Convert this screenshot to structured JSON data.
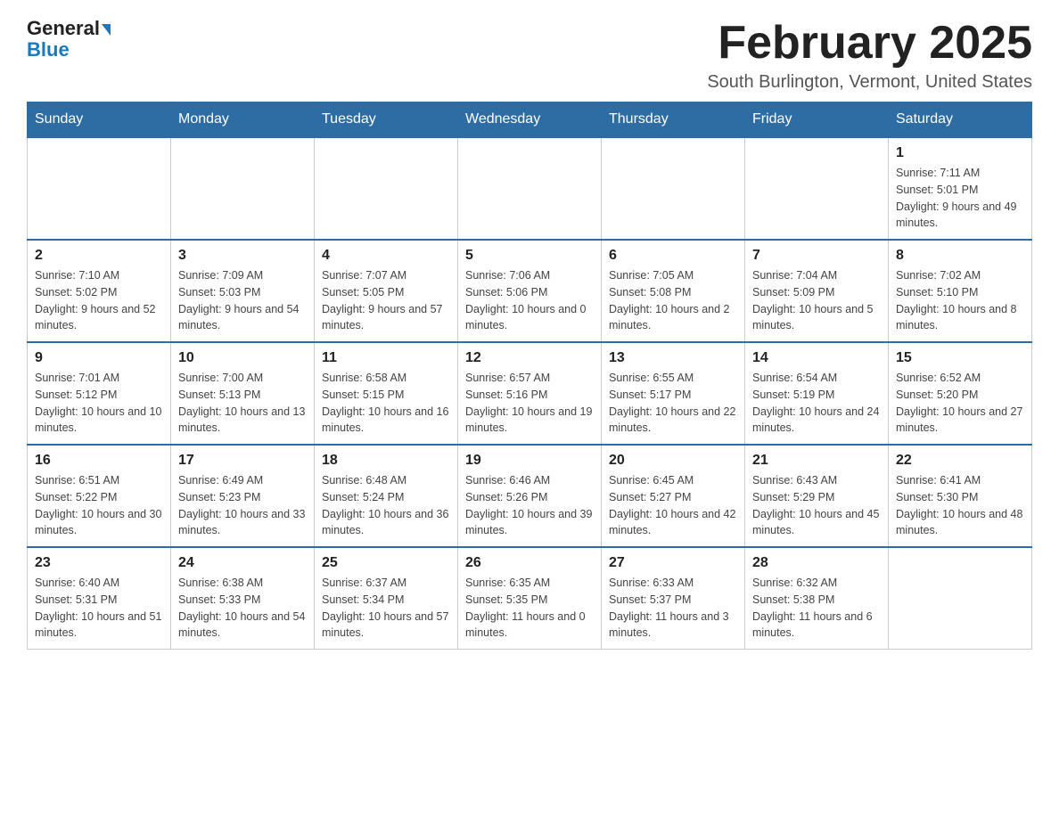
{
  "header": {
    "logo_line1": "General",
    "logo_line2": "Blue",
    "month_title": "February 2025",
    "location": "South Burlington, Vermont, United States"
  },
  "weekdays": [
    "Sunday",
    "Monday",
    "Tuesday",
    "Wednesday",
    "Thursday",
    "Friday",
    "Saturday"
  ],
  "weeks": [
    [
      {
        "day": "",
        "info": ""
      },
      {
        "day": "",
        "info": ""
      },
      {
        "day": "",
        "info": ""
      },
      {
        "day": "",
        "info": ""
      },
      {
        "day": "",
        "info": ""
      },
      {
        "day": "",
        "info": ""
      },
      {
        "day": "1",
        "info": "Sunrise: 7:11 AM\nSunset: 5:01 PM\nDaylight: 9 hours and 49 minutes."
      }
    ],
    [
      {
        "day": "2",
        "info": "Sunrise: 7:10 AM\nSunset: 5:02 PM\nDaylight: 9 hours and 52 minutes."
      },
      {
        "day": "3",
        "info": "Sunrise: 7:09 AM\nSunset: 5:03 PM\nDaylight: 9 hours and 54 minutes."
      },
      {
        "day": "4",
        "info": "Sunrise: 7:07 AM\nSunset: 5:05 PM\nDaylight: 9 hours and 57 minutes."
      },
      {
        "day": "5",
        "info": "Sunrise: 7:06 AM\nSunset: 5:06 PM\nDaylight: 10 hours and 0 minutes."
      },
      {
        "day": "6",
        "info": "Sunrise: 7:05 AM\nSunset: 5:08 PM\nDaylight: 10 hours and 2 minutes."
      },
      {
        "day": "7",
        "info": "Sunrise: 7:04 AM\nSunset: 5:09 PM\nDaylight: 10 hours and 5 minutes."
      },
      {
        "day": "8",
        "info": "Sunrise: 7:02 AM\nSunset: 5:10 PM\nDaylight: 10 hours and 8 minutes."
      }
    ],
    [
      {
        "day": "9",
        "info": "Sunrise: 7:01 AM\nSunset: 5:12 PM\nDaylight: 10 hours and 10 minutes."
      },
      {
        "day": "10",
        "info": "Sunrise: 7:00 AM\nSunset: 5:13 PM\nDaylight: 10 hours and 13 minutes."
      },
      {
        "day": "11",
        "info": "Sunrise: 6:58 AM\nSunset: 5:15 PM\nDaylight: 10 hours and 16 minutes."
      },
      {
        "day": "12",
        "info": "Sunrise: 6:57 AM\nSunset: 5:16 PM\nDaylight: 10 hours and 19 minutes."
      },
      {
        "day": "13",
        "info": "Sunrise: 6:55 AM\nSunset: 5:17 PM\nDaylight: 10 hours and 22 minutes."
      },
      {
        "day": "14",
        "info": "Sunrise: 6:54 AM\nSunset: 5:19 PM\nDaylight: 10 hours and 24 minutes."
      },
      {
        "day": "15",
        "info": "Sunrise: 6:52 AM\nSunset: 5:20 PM\nDaylight: 10 hours and 27 minutes."
      }
    ],
    [
      {
        "day": "16",
        "info": "Sunrise: 6:51 AM\nSunset: 5:22 PM\nDaylight: 10 hours and 30 minutes."
      },
      {
        "day": "17",
        "info": "Sunrise: 6:49 AM\nSunset: 5:23 PM\nDaylight: 10 hours and 33 minutes."
      },
      {
        "day": "18",
        "info": "Sunrise: 6:48 AM\nSunset: 5:24 PM\nDaylight: 10 hours and 36 minutes."
      },
      {
        "day": "19",
        "info": "Sunrise: 6:46 AM\nSunset: 5:26 PM\nDaylight: 10 hours and 39 minutes."
      },
      {
        "day": "20",
        "info": "Sunrise: 6:45 AM\nSunset: 5:27 PM\nDaylight: 10 hours and 42 minutes."
      },
      {
        "day": "21",
        "info": "Sunrise: 6:43 AM\nSunset: 5:29 PM\nDaylight: 10 hours and 45 minutes."
      },
      {
        "day": "22",
        "info": "Sunrise: 6:41 AM\nSunset: 5:30 PM\nDaylight: 10 hours and 48 minutes."
      }
    ],
    [
      {
        "day": "23",
        "info": "Sunrise: 6:40 AM\nSunset: 5:31 PM\nDaylight: 10 hours and 51 minutes."
      },
      {
        "day": "24",
        "info": "Sunrise: 6:38 AM\nSunset: 5:33 PM\nDaylight: 10 hours and 54 minutes."
      },
      {
        "day": "25",
        "info": "Sunrise: 6:37 AM\nSunset: 5:34 PM\nDaylight: 10 hours and 57 minutes."
      },
      {
        "day": "26",
        "info": "Sunrise: 6:35 AM\nSunset: 5:35 PM\nDaylight: 11 hours and 0 minutes."
      },
      {
        "day": "27",
        "info": "Sunrise: 6:33 AM\nSunset: 5:37 PM\nDaylight: 11 hours and 3 minutes."
      },
      {
        "day": "28",
        "info": "Sunrise: 6:32 AM\nSunset: 5:38 PM\nDaylight: 11 hours and 6 minutes."
      },
      {
        "day": "",
        "info": ""
      }
    ]
  ]
}
